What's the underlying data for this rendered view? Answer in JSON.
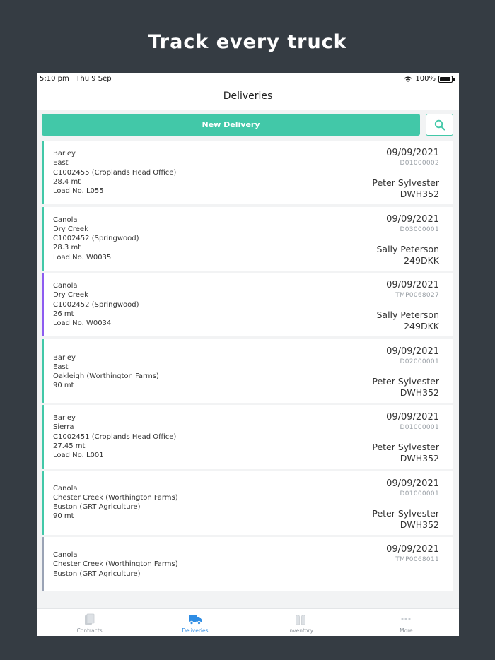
{
  "headline": "Track every truck",
  "status_bar": {
    "time": "5:10 pm",
    "date": "Thu 9 Sep",
    "battery": "100%",
    "wifi_icon": "wifi-icon",
    "battery_icon": "battery-icon"
  },
  "nav": {
    "title": "Deliveries"
  },
  "actions": {
    "new_delivery_label": "New Delivery",
    "search_icon": "search-icon"
  },
  "colors": {
    "accent": "#42c8a8",
    "purple": "#8d5cf0",
    "grey": "#9aa3b5",
    "tab_active": "#2f8de4",
    "background": "#353c43"
  },
  "deliveries": [
    {
      "lines": [
        "Barley",
        "East",
        "C1002455 (Croplands Head Office)",
        "28.4 mt",
        "Load No. L055"
      ],
      "date": "09/09/2021",
      "ref": "D01000002",
      "driver": "Peter Sylvester",
      "plate": "DWH352",
      "accent": "#42c8a8"
    },
    {
      "lines": [
        "Canola",
        "Dry Creek",
        "C1002452 (Springwood)",
        "28.3 mt",
        "Load No. W0035"
      ],
      "date": "09/09/2021",
      "ref": "D03000001",
      "driver": "Sally Peterson",
      "plate": "249DKK",
      "accent": "#42c8a8"
    },
    {
      "lines": [
        "Canola",
        "Dry Creek",
        "C1002452 (Springwood)",
        "26 mt",
        "Load No. W0034"
      ],
      "date": "09/09/2021",
      "ref": "TMP0068027",
      "driver": "Sally Peterson",
      "plate": "249DKK",
      "accent": "#8d5cf0"
    },
    {
      "lines": [
        "Barley",
        "East",
        "Oakleigh (Worthington Farms)",
        "90 mt",
        ""
      ],
      "date": "09/09/2021",
      "ref": "D02000001",
      "driver": "Peter Sylvester",
      "plate": "DWH352",
      "accent": "#42c8a8"
    },
    {
      "lines": [
        "Barley",
        "Sierra",
        "C1002451 (Croplands Head Office)",
        "27.45 mt",
        "Load No. L001"
      ],
      "date": "09/09/2021",
      "ref": "D01000001",
      "driver": "Peter Sylvester",
      "plate": "DWH352",
      "accent": "#42c8a8"
    },
    {
      "lines": [
        "Canola",
        "Chester Creek (Worthington Farms)",
        "Euston (GRT Agriculture)",
        "90 mt",
        ""
      ],
      "date": "09/09/2021",
      "ref": "D01000001",
      "driver": "Peter Sylvester",
      "plate": "DWH352",
      "accent": "#42c8a8"
    },
    {
      "lines": [
        "Canola",
        "Chester Creek (Worthington Farms)",
        "Euston (GRT Agriculture)",
        "",
        ""
      ],
      "date": "09/09/2021",
      "ref": "TMP0068011",
      "driver": "",
      "plate": "",
      "accent": "#9aa3b5"
    }
  ],
  "tabs": [
    {
      "label": "Contracts",
      "icon": "contracts-icon",
      "active": false
    },
    {
      "label": "Deliveries",
      "icon": "truck-icon",
      "active": true
    },
    {
      "label": "Inventory",
      "icon": "silo-icon",
      "active": false
    },
    {
      "label": "More",
      "icon": "more-icon",
      "active": false
    }
  ]
}
